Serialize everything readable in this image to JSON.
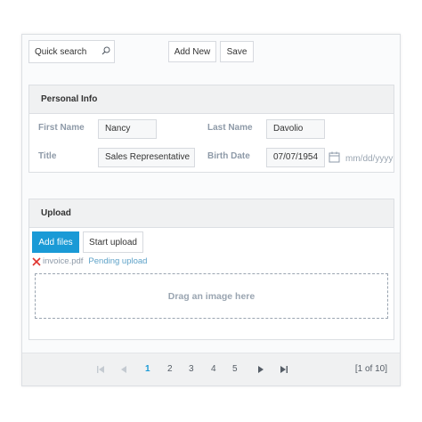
{
  "toolbar": {
    "search_placeholder": "Quick search",
    "add_new_label": "Add New",
    "save_label": "Save"
  },
  "personal_info": {
    "title": "Personal Info",
    "first_name_label": "First Name",
    "first_name_value": "Nancy",
    "last_name_label": "Last Name",
    "last_name_value": "Davolio",
    "title_label": "Title",
    "title_value": "Sales Representative",
    "birth_date_label": "Birth Date",
    "birth_date_value": "07/07/1954",
    "birth_date_format_hint": "mm/dd/yyyy"
  },
  "upload": {
    "title": "Upload",
    "add_files_label": "Add files",
    "start_upload_label": "Start upload",
    "file_name": "invoice.pdf",
    "file_status": "Pending upload",
    "dropzone_text": "Drag an image here"
  },
  "pager": {
    "pages": [
      "1",
      "2",
      "3",
      "4",
      "5"
    ],
    "current_page": "1",
    "info": "[1 of 10]"
  },
  "colors": {
    "accent": "#1a9ad6",
    "remove_icon": "#e0332e"
  },
  "icons": [
    "search-icon",
    "calendar-icon",
    "remove-file-icon",
    "first-page-icon",
    "previous-page-icon",
    "next-page-icon",
    "last-page-icon"
  ]
}
